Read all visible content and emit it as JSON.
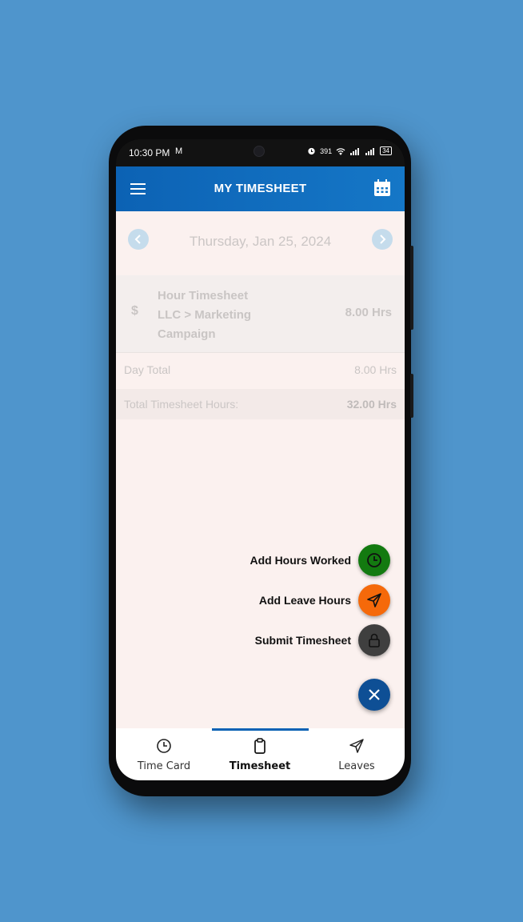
{
  "status_bar": {
    "time": "10:30 PM",
    "mail_glyph": "M",
    "net_speed": "391",
    "battery": "34"
  },
  "app_bar": {
    "title": "MY TIMESHEET"
  },
  "date_nav": {
    "date": "Thursday, Jan 25, 2024"
  },
  "entry": {
    "currency_symbol": "$",
    "name_line1": "Hour Timesheet",
    "name_line2": "LLC > Marketing",
    "name_line3": "Campaign",
    "hours": "8.00 Hrs"
  },
  "day_total": {
    "label": "Day Total",
    "value": "8.00 Hrs"
  },
  "total_timesheet": {
    "label": "Total Timesheet Hours:",
    "value": "32.00 Hrs"
  },
  "fab_menu": {
    "items": [
      {
        "label": "Add Hours Worked",
        "icon": "clock-icon",
        "color": "#137a10"
      },
      {
        "label": "Add Leave Hours",
        "icon": "send-icon",
        "color": "#f5690a"
      },
      {
        "label": "Submit Timesheet",
        "icon": "lock-icon",
        "color": "#3f3f3f"
      }
    ],
    "main_color": "#0e4f95"
  },
  "bottom_nav": {
    "tabs": [
      {
        "label": "Time Card",
        "icon": "clock-icon"
      },
      {
        "label": "Timesheet",
        "icon": "clipboard-icon"
      },
      {
        "label": "Leaves",
        "icon": "send-icon"
      }
    ],
    "active_index": 1
  },
  "colors": {
    "background": "#4f95cc",
    "app_bar": "#0c62b4",
    "content_bg": "#fbf1ef"
  }
}
